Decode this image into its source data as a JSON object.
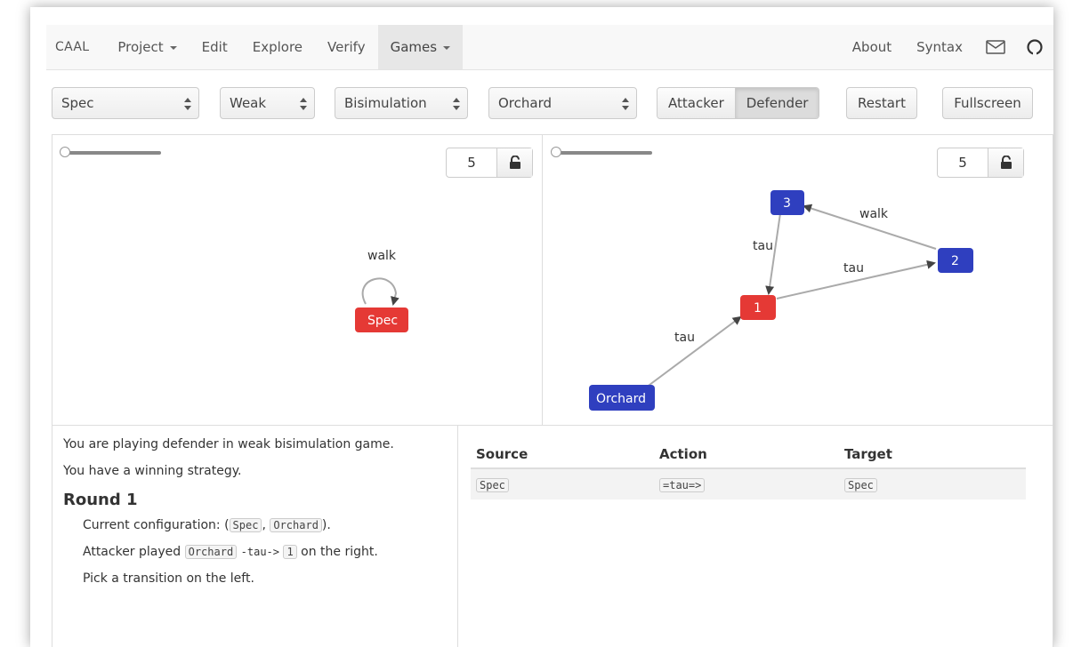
{
  "nav": {
    "brand": "CAAL",
    "items": [
      {
        "label": "Project",
        "dropdown": true
      },
      {
        "label": "Edit"
      },
      {
        "label": "Explore"
      },
      {
        "label": "Verify"
      },
      {
        "label": "Games",
        "dropdown": true,
        "active": true
      }
    ],
    "right": [
      {
        "label": "About"
      },
      {
        "label": "Syntax"
      }
    ],
    "icons": [
      "mail-icon",
      "github-icon"
    ]
  },
  "toolbar": {
    "process_left": "Spec",
    "strength": "Weak",
    "relation": "Bisimulation",
    "process_right": "Orchard",
    "role_attacker": "Attacker",
    "role_defender": "Defender",
    "active_role": "Defender",
    "restart": "Restart",
    "fullscreen": "Fullscreen"
  },
  "left_graph": {
    "zoom": "5",
    "nodes": [
      {
        "id": "Spec",
        "label": "Spec",
        "color": "#e53935"
      }
    ],
    "edges": [
      {
        "from": "Spec",
        "to": "Spec",
        "label": "walk"
      }
    ]
  },
  "right_graph": {
    "zoom": "5",
    "nodes": [
      {
        "id": "3",
        "label": "3",
        "color": "#2f3fbf"
      },
      {
        "id": "2",
        "label": "2",
        "color": "#2f3fbf"
      },
      {
        "id": "1",
        "label": "1",
        "color": "#e53935"
      },
      {
        "id": "Orchard",
        "label": "Orchard",
        "color": "#2f3fbf"
      }
    ],
    "edges": [
      {
        "from": "2",
        "to": "3",
        "label": "walk"
      },
      {
        "from": "3",
        "to": "1",
        "label": "tau"
      },
      {
        "from": "1",
        "to": "2",
        "label": "tau"
      },
      {
        "from": "Orchard",
        "to": "1",
        "label": "tau"
      }
    ]
  },
  "log": {
    "line1": "You are playing defender in weak bisimulation game.",
    "line2": "You have a winning strategy.",
    "round": "Round 1",
    "config_prefix": "Current configuration: (",
    "config_left": "Spec",
    "config_sep": ", ",
    "config_right": "Orchard",
    "config_suffix": ").",
    "attack_prefix": "Attacker played",
    "attack_from": "Orchard",
    "attack_action": "-tau->",
    "attack_to": "1",
    "attack_suffix": "on the right.",
    "pick": "Pick a transition on the left."
  },
  "table": {
    "headers": [
      "Source",
      "Action",
      "Target"
    ],
    "rows": [
      [
        "Spec",
        "=tau=>",
        "Spec"
      ]
    ]
  }
}
